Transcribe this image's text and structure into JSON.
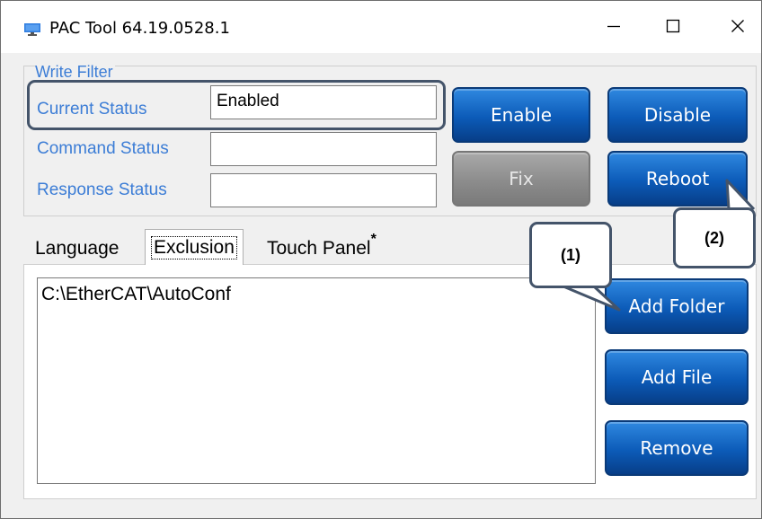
{
  "window": {
    "title": "PAC Tool 64.19.0528.1"
  },
  "write_filter": {
    "legend": "Write Filter",
    "current_status": {
      "label": "Current Status",
      "value": "Enabled"
    },
    "command_status": {
      "label": "Command Status",
      "value": ""
    },
    "response_status": {
      "label": "Response Status",
      "value": ""
    },
    "buttons": {
      "enable": "Enable",
      "disable": "Disable",
      "fix": "Fix",
      "reboot": "Reboot"
    }
  },
  "tabs": [
    {
      "label": "Language",
      "active": false
    },
    {
      "label": "Exclusion",
      "active": true
    },
    {
      "label": "Touch Panel",
      "active": false,
      "marker": "*"
    }
  ],
  "exclusion": {
    "items": [
      "C:\\EtherCAT\\AutoConf"
    ],
    "buttons": {
      "add_folder": "Add Folder",
      "add_file": "Add File",
      "remove": "Remove"
    }
  },
  "callouts": {
    "one": "(1)",
    "two": "(2)"
  },
  "colors": {
    "label_blue": "#3c7dd6",
    "button_blue": "#0c5bb8",
    "disabled_gray": "#8c8c8c",
    "callout_border": "#44546a"
  },
  "icons": {
    "app": "monitor-icon",
    "minimize": "minimize-icon",
    "maximize": "maximize-icon",
    "close": "close-icon"
  }
}
